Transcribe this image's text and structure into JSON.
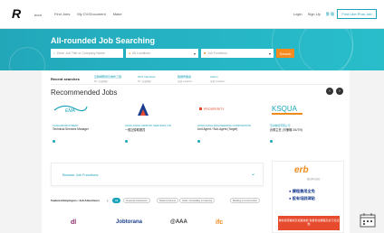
{
  "header": {
    "logo_text": "bout",
    "nav": [
      "Find Jobs",
      "My CV/Document",
      "Make"
    ],
    "links": [
      "Login",
      "Sign Up",
      "繁 簡"
    ],
    "employer_button": "Find Like Pros Job"
  },
  "hero": {
    "title": "All-rounded Job Searching",
    "search_placeholder": "Enter Job Title or Company Name",
    "location_placeholder": "All Locations",
    "function_placeholder": "Job Functions",
    "search_button": "Search"
  },
  "recent": {
    "label": "Recent searches",
    "items": [
      {
        "title": "互聯網應用及維修工程",
        "sub": "9K | 全部地區"
      },
      {
        "title": "KFO Volunteer",
        "sub": "3K | 全部地區"
      },
      {
        "title": "數碼營業員",
        "sub": "全部 Locations"
      },
      {
        "title": "Admin",
        "sub": "全部 Locations"
      }
    ]
  },
  "recommended": {
    "title": "Recommended Jobs",
    "prev_label": "‹",
    "next_label": "›",
    "jobs": [
      {
        "company": "CANA RECRUITMENT",
        "title": "Technical Services Manager",
        "logo": "EMA"
      },
      {
        "company": "HONG KONG AIRPORT SERVICES LTD",
        "title": "一般記錄助理員",
        "logo": "A"
      },
      {
        "company": "HONG KONG ENGINEERING CORPORATION",
        "title": "Unit Agent / Sub-Agent (Target)",
        "logo": "PROSPERITY"
      },
      {
        "company": "亞洲物流有限公司",
        "title": "倉務主任 (可兼職 3/4/7/9)",
        "logo": "KSQUA"
      }
    ]
  },
  "functions": {
    "label": "Browse Job Functions",
    "chevron": "⌄"
  },
  "featured": {
    "label": "Featured Employers / Job Advertisers",
    "all_chip": "All",
    "chips": [
      "Financial Institutions",
      "Retail & Fitness",
      "Hotel / Hospitality & Catering",
      "Building & Construction"
    ],
    "employers": [
      "dl",
      "Jobtorana",
      "@AAA",
      "ifc"
    ]
  },
  "erb": {
    "logo": "erb",
    "sub": "僱員再培訓局",
    "lines": [
      "● 課程費用全免",
      "● 設有培訓津貼"
    ],
    "banner": "重新探索職場及拓展技能 免費參加課程及多元化活動"
  },
  "colors": {
    "brand": "#1aa3b8",
    "hero": "#22a7b9",
    "search_button": "#f58a1f",
    "erb_orange": "#f08a1d",
    "erb_blue": "#1a3d8f"
  }
}
